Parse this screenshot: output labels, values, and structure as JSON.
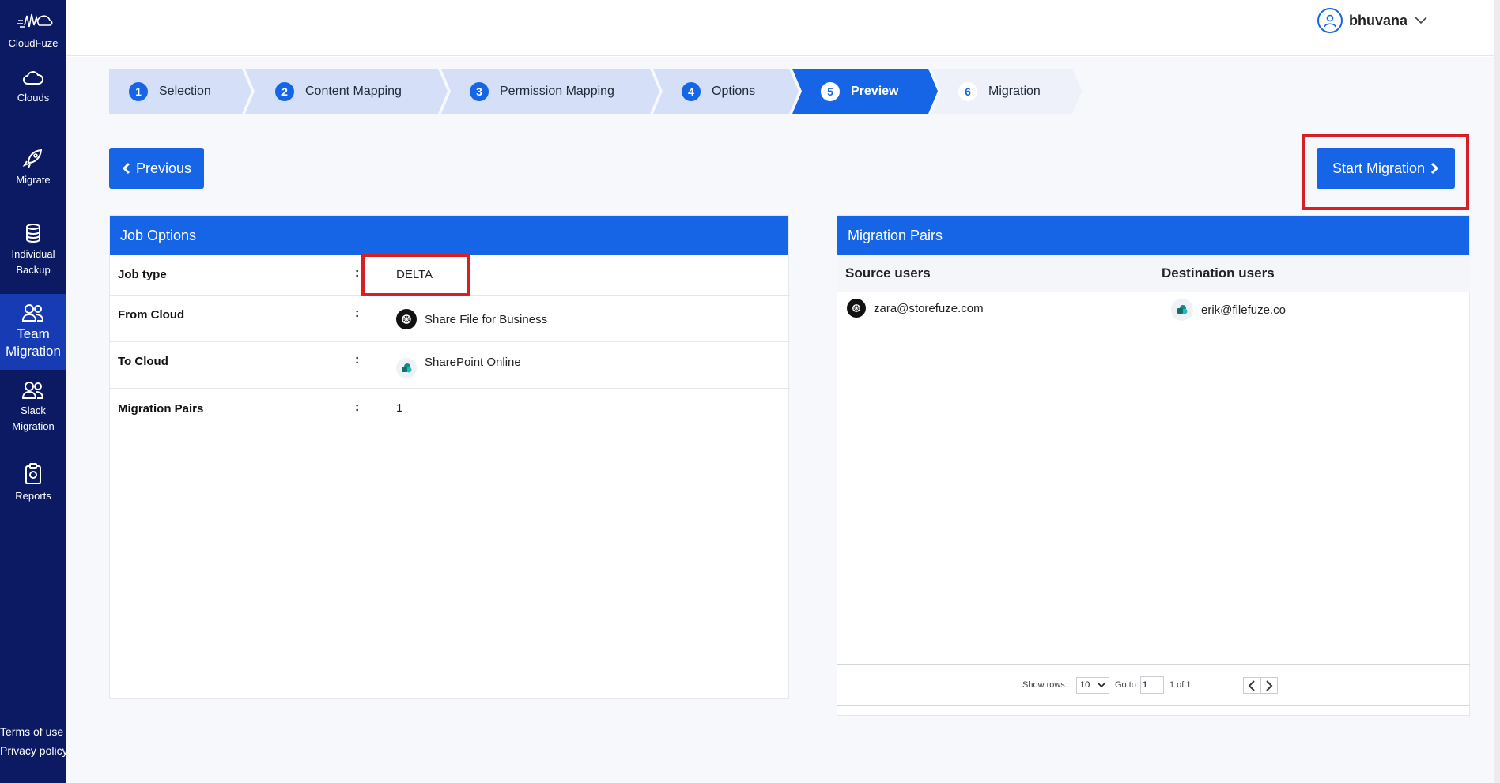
{
  "brand": {
    "name": "CloudFuze",
    "icon": "cloudfuze-logo"
  },
  "sidebar": {
    "items": [
      {
        "label": "Clouds",
        "icon": "cloud-icon"
      },
      {
        "label": "Migrate",
        "icon": "rocket-icon"
      },
      {
        "label": "Individual Backup",
        "icon": "database-icon"
      },
      {
        "label": "Team Migration",
        "icon": "team-icon",
        "active": true
      },
      {
        "label": "Slack Migration",
        "icon": "team-icon"
      },
      {
        "label": "Reports",
        "icon": "clipboard-icon"
      }
    ],
    "footer": {
      "terms": "Terms of use",
      "privacy": "Privacy policy"
    }
  },
  "header": {
    "username": "bhuvana"
  },
  "stepper": {
    "steps": [
      {
        "num": "1",
        "label": "Selection",
        "state": "done"
      },
      {
        "num": "2",
        "label": "Content Mapping",
        "state": "done"
      },
      {
        "num": "3",
        "label": "Permission Mapping",
        "state": "done"
      },
      {
        "num": "4",
        "label": "Options",
        "state": "done"
      },
      {
        "num": "5",
        "label": "Preview",
        "state": "active"
      },
      {
        "num": "6",
        "label": "Migration",
        "state": "future"
      }
    ]
  },
  "actions": {
    "previous": "Previous",
    "start": "Start Migration"
  },
  "job_options": {
    "title": "Job Options",
    "rows": [
      {
        "key": "Job type",
        "sep": ":",
        "value": "DELTA"
      },
      {
        "key": "From Cloud",
        "sep": ":",
        "value": "Share File for Business"
      },
      {
        "key": "To Cloud",
        "sep": ":",
        "value": "SharePoint Online"
      },
      {
        "key": "Migration Pairs",
        "sep": ":",
        "value": "1"
      }
    ]
  },
  "migration_pairs": {
    "title": "Migration Pairs",
    "columns": [
      "Source users",
      "Destination users"
    ],
    "rows": [
      {
        "source": "zara@storefuze.com",
        "destination": "erik@filefuze.co"
      }
    ],
    "pager": {
      "show_rows_label": "Show rows:",
      "rows_value": "10",
      "goto_label": "Go to:",
      "goto_value": "1",
      "page_info": "1 of 1"
    }
  },
  "colors": {
    "primary": "#1565e6",
    "sidebar": "#0b1a63",
    "highlight": "#d81f26",
    "step_bg": "#d6dff8"
  }
}
